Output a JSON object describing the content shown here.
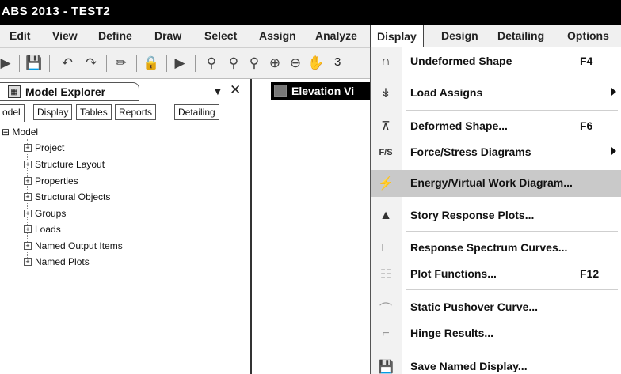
{
  "window": {
    "title": "ABS 2013 - TEST2"
  },
  "menubar": {
    "items": [
      {
        "label": "Edit"
      },
      {
        "label": "View"
      },
      {
        "label": "Define"
      },
      {
        "label": "Draw"
      },
      {
        "label": "Select"
      },
      {
        "label": "Assign"
      },
      {
        "label": "Analyze"
      },
      {
        "label": "Display"
      },
      {
        "label": "Design"
      },
      {
        "label": "Detailing"
      },
      {
        "label": "Options"
      }
    ]
  },
  "toolbar": {
    "icons": [
      "arrow-icon",
      "save-icon",
      "undo-icon",
      "redo-icon",
      "pencil-icon",
      "lock-icon",
      "run-icon",
      "zoom-window-icon",
      "zoom-restore-icon",
      "zoom-previous-icon",
      "zoom-in-icon",
      "zoom-out-icon",
      "pan-icon"
    ],
    "trailing_text": "3"
  },
  "explorer": {
    "title": "Model Explorer",
    "tabs": [
      "odel",
      "Display",
      "Tables",
      "Reports",
      "Detailing"
    ],
    "root": "Model",
    "items": [
      "Project",
      "Structure Layout",
      "Properties",
      "Structural Objects",
      "Groups",
      "Loads",
      "Named Output Items",
      "Named Plots"
    ]
  },
  "elevation": {
    "title": "Elevation Vi"
  },
  "display_menu": {
    "items": [
      {
        "label": "Undeformed Shape",
        "shortcut": "F4",
        "submenu": false,
        "icon": "undeformed-shape-icon"
      },
      {
        "label": "Load Assigns",
        "shortcut": "",
        "submenu": true,
        "icon": "load-assigns-icon"
      },
      {
        "label": "Deformed Shape...",
        "shortcut": "F6",
        "submenu": false,
        "icon": "deformed-shape-icon"
      },
      {
        "label": "Force/Stress Diagrams",
        "shortcut": "",
        "submenu": true,
        "icon": "force-stress-icon"
      },
      {
        "label": "Energy/Virtual Work Diagram...",
        "shortcut": "",
        "submenu": false,
        "icon": "energy-icon",
        "highlighted": true
      },
      {
        "label": "Story Response Plots...",
        "shortcut": "",
        "submenu": false,
        "icon": "story-response-icon"
      },
      {
        "label": "Response Spectrum Curves...",
        "shortcut": "",
        "submenu": false,
        "icon": "response-spectrum-icon"
      },
      {
        "label": "Plot Functions...",
        "shortcut": "F12",
        "submenu": false,
        "icon": "plot-functions-icon"
      },
      {
        "label": "Static Pushover Curve...",
        "shortcut": "",
        "submenu": false,
        "icon": "pushover-curve-icon"
      },
      {
        "label": "Hinge Results...",
        "shortcut": "",
        "submenu": false,
        "icon": "hinge-results-icon"
      },
      {
        "label": "Save Named Display...",
        "shortcut": "",
        "submenu": false,
        "icon": "save-named-display-icon"
      }
    ]
  }
}
